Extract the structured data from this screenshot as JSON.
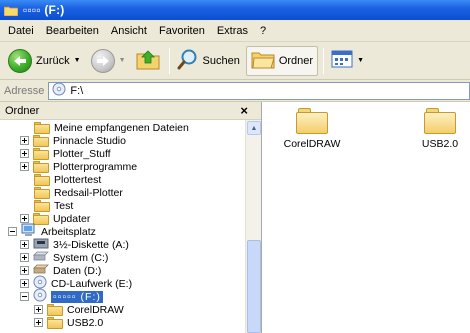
{
  "window": {
    "title": "▫▫▫▫ (F:)"
  },
  "menu": [
    "Datei",
    "Bearbeiten",
    "Ansicht",
    "Favoriten",
    "Extras",
    "?"
  ],
  "toolbar": {
    "back_label": "Zurück",
    "search_label": "Suchen",
    "folders_label": "Ordner"
  },
  "address": {
    "label": "Adresse",
    "value": "F:\\"
  },
  "folder_pane": {
    "title": "Ordner",
    "close": "×",
    "items": [
      {
        "label": "Meine empfangenen Dateien",
        "icon": "folder-icon"
      },
      {
        "label": "Pinnacle Studio",
        "icon": "folder-icon"
      },
      {
        "label": "Plotter_Stuff",
        "icon": "folder-icon"
      },
      {
        "label": "Plotterprogramme",
        "icon": "folder-icon"
      },
      {
        "label": "Plottertest",
        "icon": "folder-icon"
      },
      {
        "label": "Redsail-Plotter",
        "icon": "folder-icon"
      },
      {
        "label": "Test",
        "icon": "folder-icon"
      },
      {
        "label": "Updater",
        "icon": "folder-icon"
      },
      {
        "label": "Arbeitsplatz",
        "icon": "my-computer-icon"
      },
      {
        "label": "3½-Diskette (A:)",
        "icon": "floppy-drive-icon"
      },
      {
        "label": "System (C:)",
        "icon": "hard-drive-icon"
      },
      {
        "label": "Daten (D:)",
        "icon": "hard-drive-icon"
      },
      {
        "label": "CD-Laufwerk (E:)",
        "icon": "cd-drive-icon"
      },
      {
        "label": "▫▫▫▫▫ (F:)",
        "icon": "cd-drive-icon",
        "selected": true
      },
      {
        "label": "CorelDRAW",
        "icon": "folder-icon"
      },
      {
        "label": "USB2.0",
        "icon": "folder-icon"
      }
    ]
  },
  "content": {
    "items": [
      {
        "label": "CorelDRAW",
        "icon": "folder-icon"
      },
      {
        "label": "USB2.0",
        "icon": "folder-icon"
      }
    ]
  },
  "colors": {
    "titlebar": "#0b4ed1",
    "selection": "#316ac5",
    "chrome": "#ece9d8"
  }
}
